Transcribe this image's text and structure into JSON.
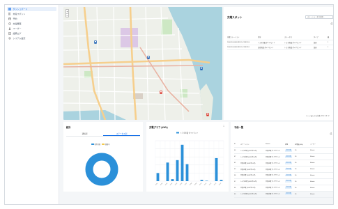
{
  "sidebar": {
    "items": [
      {
        "label": "ダッシュボード",
        "icon": "dashboard-icon",
        "active": true
      },
      {
        "label": "充電スポット",
        "icon": "charging-station-icon",
        "active": false
      },
      {
        "label": "予約",
        "icon": "calendar-icon",
        "active": false
      },
      {
        "label": "充電履歴",
        "icon": "history-icon",
        "active": false
      },
      {
        "label": "ユーザー",
        "icon": "user-icon",
        "active": false
      },
      {
        "label": "設備ログ",
        "icon": "log-icon",
        "active": false
      },
      {
        "label": "システム設定",
        "icon": "settings-icon",
        "active": false
      }
    ]
  },
  "map": {
    "zoom_in": "+",
    "zoom_out": "−"
  },
  "spots": {
    "title": "充電スポット",
    "search_placeholder": "ステーション名で検索...",
    "columns": [
      "充電ステーション",
      "名前",
      "ステータス",
      "タイプ",
      "最"
    ],
    "rows": [
      [
        "20000100-B46CB5CD-CF8D1D4",
        "トヨタ充電 ダイヤモンド",
        "トヨタ充電 ダイヤモンド",
        "急速",
        "1"
      ],
      [
        "20000100-B46CB5CD-CF8D2D1",
        "日産充電 ダイヤモンド",
        "トヨタ充電 ダイヤモンド",
        "急速",
        "1"
      ]
    ],
    "footer": "ページあたりの行数: 10  ▾  1-2 / 2"
  },
  "stats": {
    "title": "統計",
    "tabs": [
      "通知別",
      "ステータス別"
    ],
    "active_tab": 1,
    "legend": [
      {
        "label": "利用可能",
        "color": "#2b90d9"
      },
      {
        "label": "故障中",
        "color": "#f2c94c"
      }
    ],
    "donut_color": "#2b90d9"
  },
  "graph": {
    "title": "充電グラフ (kWh)",
    "expand_icon": "expand-icon"
  },
  "chart_data": {
    "type": "bar",
    "title": "充電グラフ (kWh)",
    "series": [
      {
        "name": "トヨタ充電 ダイヤモンド",
        "values": [
          20,
          0,
          46,
          5,
          52,
          90,
          42,
          0,
          0,
          3,
          1,
          0,
          57,
          3
        ]
      }
    ],
    "categories": [
      "10/01",
      "10/02",
      "10/03",
      "10/04",
      "10/05",
      "10/06",
      "10/07",
      "10/08",
      "10/09",
      "10/10",
      "10/11",
      "10/12",
      "10/13",
      "10/14"
    ],
    "ylim": [
      0,
      100
    ],
    "grid": true,
    "legend_position": "top",
    "color": "#2b90d9"
  },
  "history": {
    "title": "予約一覧",
    "columns": [
      "ID",
      "ステーション",
      "Station",
      "状態",
      "充電量(kWh)",
      "ユーザー"
    ],
    "rows": [
      [
        "46",
        "トヨタ充電 (2023年10月)",
        "日産充電 ダイヤモンド",
        "利用可能",
        "30",
        "Mariah"
      ],
      [
        "47",
        "トヨタ充電 (2023年10月)",
        "日産充電 ダイヤモンド",
        "利用可能",
        "30",
        "Mariah"
      ],
      [
        "42",
        "日産充電 (2023年10月)",
        "日産充電 ダイヤモンド",
        "利用可能",
        "30",
        "Mariah"
      ],
      [
        "40",
        "日産充電 (2023年10月)",
        "日産充電 ダイヤモンド",
        "利用可能",
        "30",
        "Mariah"
      ],
      [
        "38",
        "日産充電 (2023年10月)",
        "日産充電 ダイヤモンド",
        "利用可能",
        "30",
        "Mariah"
      ],
      [
        "37",
        "トヨタ充電 (2023年10月)",
        "日産充電 ダイヤモンド",
        "利用可能",
        "30",
        "Mariah"
      ],
      [
        "36",
        "日産充電 (2023年10月)",
        "日産充電 ダイヤモンド",
        "利用可能",
        "30",
        "Mariah"
      ],
      [
        "33",
        "トヨタ充電 (2023年10月)",
        "日産充電 ダイヤモンド",
        "利用可能",
        "30",
        "Mariah"
      ]
    ]
  },
  "colors": {
    "accent": "#1a73e8",
    "bar": "#2b90d9",
    "background": "#f4f6f8"
  }
}
